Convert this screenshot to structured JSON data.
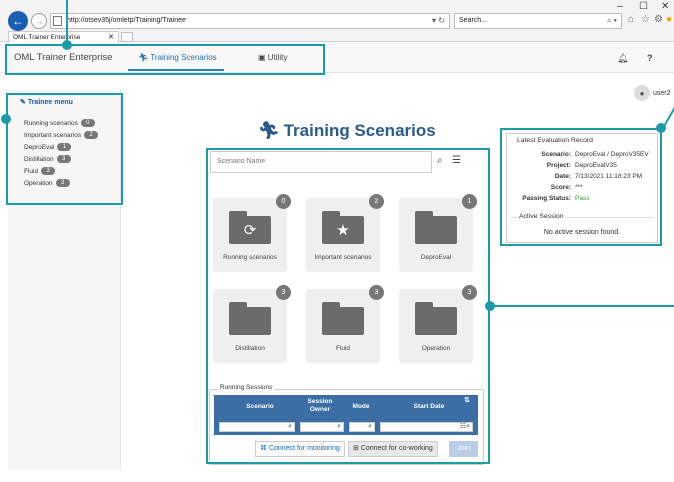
{
  "browser": {
    "url": "http://otsev35j/omletp/Training/Trainee",
    "search_placeholder": "Search...",
    "tab_title": "OML Trainer Enterprise",
    "win_min": "–",
    "win_max": "☐",
    "win_close": "✕"
  },
  "header": {
    "brand": "OML Trainer Enterprise",
    "nav_training": "Training Scenarios",
    "nav_utility": "Utility",
    "user": "user2"
  },
  "sidebar": {
    "title": "Trainee menu",
    "items": [
      {
        "label": "Running scenarios",
        "count": "0"
      },
      {
        "label": "Important scenarios",
        "count": "2"
      },
      {
        "label": "DeproEval",
        "count": "1"
      },
      {
        "label": "Distillation",
        "count": "3"
      },
      {
        "label": "Fluid",
        "count": "3"
      },
      {
        "label": "Operation",
        "count": "3"
      }
    ]
  },
  "main": {
    "title": "Training Scenarios",
    "search_placeholder": "Scenario Name",
    "tiles": [
      {
        "label": "Running scenarios",
        "count": "0",
        "glyph": "⟳"
      },
      {
        "label": "Important scenarios",
        "count": "2",
        "glyph": "★"
      },
      {
        "label": "DeproEval",
        "count": "1",
        "glyph": ""
      },
      {
        "label": "Distillation",
        "count": "3",
        "glyph": ""
      },
      {
        "label": "Fluid",
        "count": "3",
        "glyph": ""
      },
      {
        "label": "Operation",
        "count": "3",
        "glyph": ""
      }
    ]
  },
  "sessions": {
    "legend": "Running Sessions",
    "columns": [
      "Scenario",
      "Session Owner",
      "Mode",
      "Start Date"
    ],
    "buttons": {
      "monitor": "Connect for monitoring",
      "cowork": "Connect for co-working",
      "join": "Join"
    }
  },
  "evaluation": {
    "title": "Latest Evaluation Record",
    "rows": [
      {
        "key": "Scenario:",
        "value": "DeproEval / DeproV35EV"
      },
      {
        "key": "Project:",
        "value": "DeproEvalV35"
      },
      {
        "key": "Date:",
        "value": "7/13/2021 11:18:23 PM"
      },
      {
        "key": "Score:",
        "value": "***"
      },
      {
        "key": "Passing Status:",
        "value": "Pass"
      }
    ],
    "active_legend": "Active Session",
    "active_text": "No active session found."
  },
  "colors": {
    "annotation": "#1a9ba7",
    "brand_blue": "#1a6fb4",
    "table_header": "#3a6ea5"
  }
}
